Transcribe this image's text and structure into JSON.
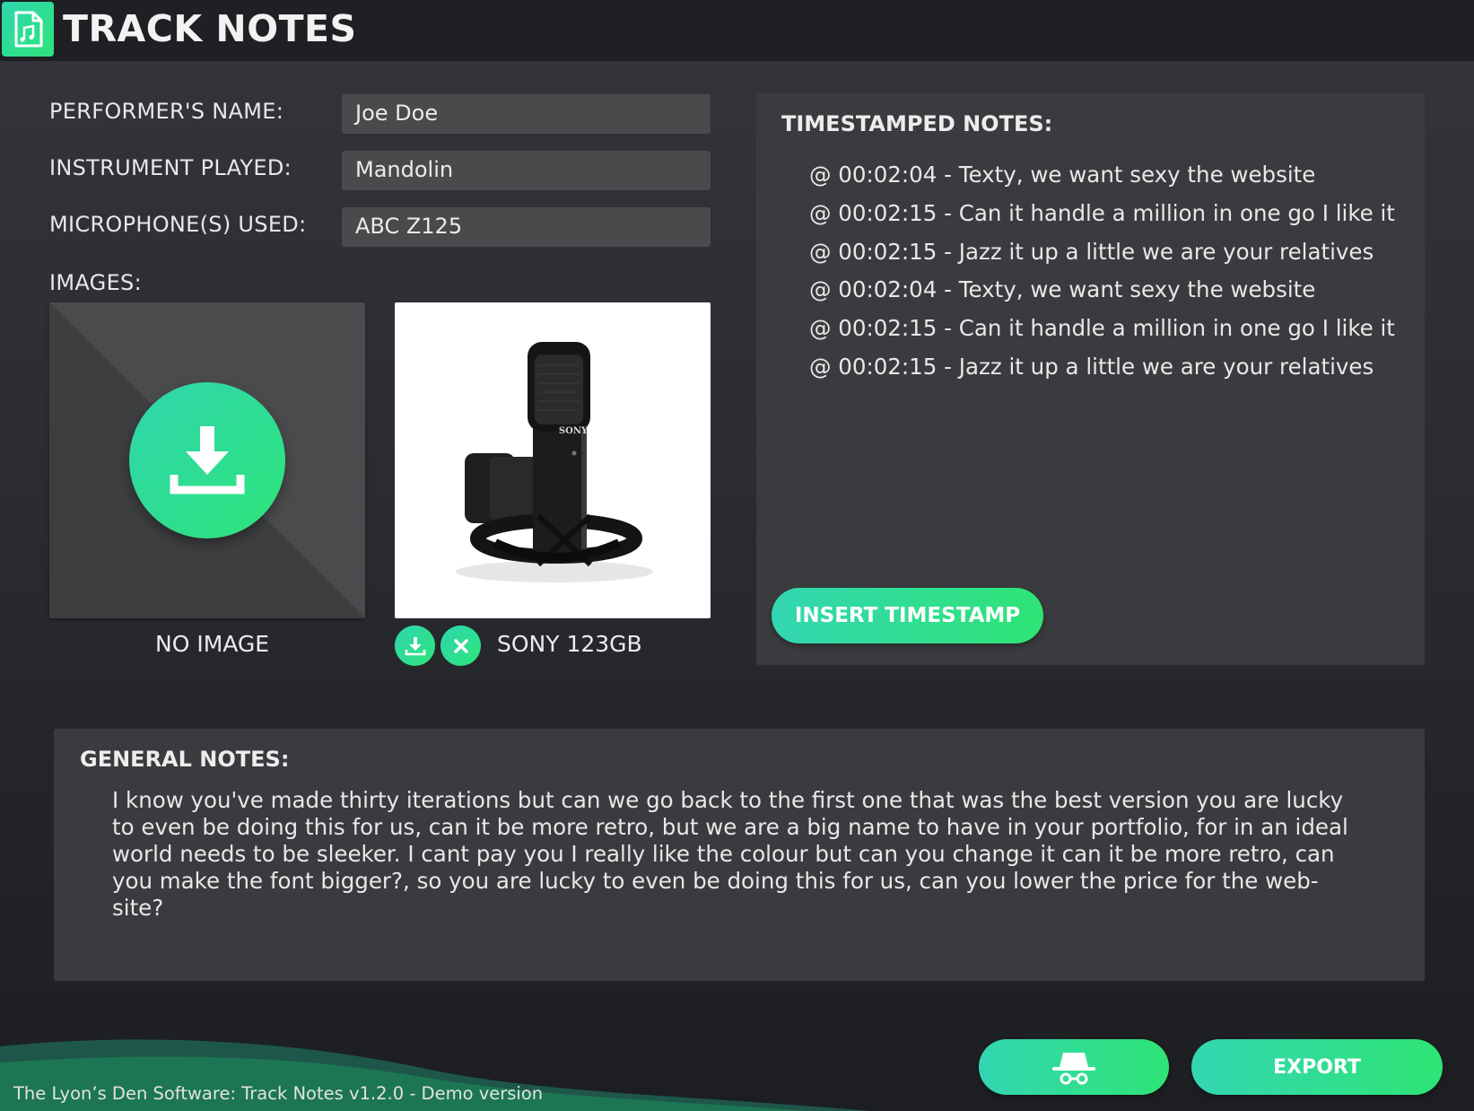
{
  "app": {
    "title": "TRACK NOTES",
    "icon": "music-file-icon"
  },
  "fields": {
    "performer": {
      "label": "PERFORMER'S NAME:",
      "value": "Joe Doe"
    },
    "instrument": {
      "label": "INSTRUMENT PLAYED:",
      "value": "Mandolin"
    },
    "microphone": {
      "label": "MICROPHONE(S) USED:",
      "value": "ABC Z125"
    }
  },
  "images": {
    "label": "IMAGES:",
    "empty_slot": {
      "caption": "NO IMAGE",
      "icon": "download-icon"
    },
    "photo_slot": {
      "caption": "SONY 123GB",
      "brand_mark": "SONY",
      "actions": [
        "download-icon",
        "close-icon"
      ]
    }
  },
  "timestamped": {
    "title": "TIMESTAMPED NOTES:",
    "notes": [
      "@ 00:02:04 - Texty, we want sexy the website",
      "@ 00:02:15 - Can it handle a million in one go I like it",
      "@ 00:02:15 - Jazz it up a little we are your relatives",
      "@ 00:02:04 - Texty, we want sexy the website",
      "@ 00:02:15 - Can it handle a million in one go I like it",
      "@ 00:02:15 - Jazz it up a little we are your relatives"
    ],
    "insert_button": "INSERT TIMESTAMP"
  },
  "general": {
    "title": "GENERAL NOTES:",
    "lines": [
      "I know you've made thirty iterations but can we go back to the first one that was the best version you are lucky",
      "to even be doing this for us, can it be more retro, but we are a big name to have in your portfolio, for in an ideal",
      "world needs to be sleeker. I cant pay you I really like the colour but can you change it can it be more retro, can",
      "you make the font bigger?, so you are lucky to even be doing this for us, can you lower the price for the web-",
      "site?"
    ]
  },
  "actions": {
    "incognito_icon": "incognito-icon",
    "export_label": "EXPORT"
  },
  "footer": {
    "text": "The Lyon’s Den Software: Track Notes v1.2.0 - Demo version"
  },
  "colors": {
    "accent_start": "#2fd6ae",
    "accent_end": "#2ee47a",
    "panel": "#3a3b3e",
    "input": "#4a4a4c"
  }
}
